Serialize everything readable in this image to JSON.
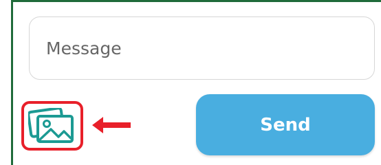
{
  "composer": {
    "message_placeholder": "Message",
    "message_value": "",
    "send_label": "Send"
  },
  "icons": {
    "image_attach": "image-gallery-icon",
    "highlight_arrow": "left-arrow-icon"
  },
  "colors": {
    "send_button": "#49aee0",
    "image_icon": "#1c9a93",
    "highlight": "#e8202a",
    "frame_border": "#1f6b3a"
  }
}
